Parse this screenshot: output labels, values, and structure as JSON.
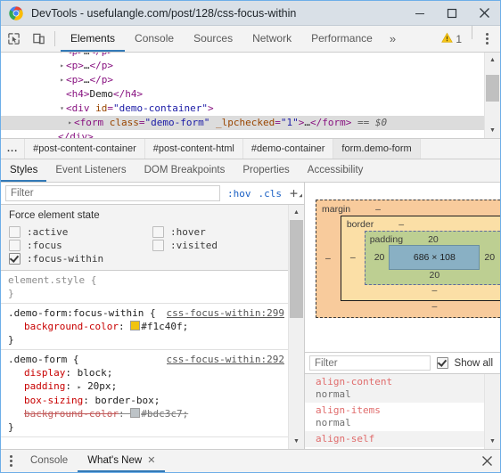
{
  "window": {
    "title": "DevTools - usefulangle.com/post/128/css-focus-within",
    "logo_icon": "chrome-logo-icon",
    "minimize_label": "—",
    "maximize_label": "□",
    "close_label": "✕"
  },
  "toolbar": {
    "inspect_icon": "inspect-element-icon",
    "device_icon": "device-toolbar-icon",
    "tabs": [
      {
        "label": "Elements",
        "active": true
      },
      {
        "label": "Console",
        "active": false
      },
      {
        "label": "Sources",
        "active": false
      },
      {
        "label": "Network",
        "active": false
      },
      {
        "label": "Performance",
        "active": false
      }
    ],
    "more_label": "»",
    "warning_icon": "warning-triangle-icon",
    "warning_count": "1",
    "menu_icon": "kebab-menu-icon"
  },
  "dom_tree": {
    "lines": [
      {
        "indent": 4,
        "tri": "▸",
        "html": "p-ellipsis",
        "selected": false,
        "clipped_top": true
      },
      {
        "indent": 4,
        "tri": "▸",
        "html": "p-ellipsis",
        "selected": false
      },
      {
        "indent": 4,
        "tri": "▸",
        "html": "p-ellipsis",
        "selected": false
      },
      {
        "indent": 5,
        "tri": "",
        "html": "h4-demo",
        "selected": false
      },
      {
        "indent": 4,
        "tri": "▾",
        "html": "div-demo-container",
        "selected": false
      },
      {
        "indent": 5,
        "tri": "▸",
        "html": "form-demo-form",
        "selected": true
      },
      {
        "indent": 4,
        "tri": "",
        "html": "div-close",
        "selected": false,
        "clipped_bottom": true
      }
    ],
    "text": {
      "p_open": "<p>",
      "p_ellipsis": "…",
      "p_close": "</p>",
      "h4_open": "<h4>",
      "h4_text": "Demo",
      "h4_close": "</h4>",
      "div_open": "<div",
      "div_attr_name": "id",
      "div_attr_value": "\"demo-container\"",
      "gt": ">",
      "form_open": "<form",
      "form_class_name": "class",
      "form_class_value": "\"demo-form\"",
      "form_lp_name": "_lpchecked",
      "form_lp_value": "\"1\"",
      "form_close": "</form>",
      "dollar_ref": "== $0",
      "div_close": "</div>"
    }
  },
  "breadcrumb": {
    "overflow": "...",
    "items": [
      "#post-content-container",
      "#post-content-html",
      "#demo-container",
      "form.demo-form"
    ]
  },
  "sidebar_tabs": [
    {
      "label": "Styles",
      "active": true
    },
    {
      "label": "Event Listeners",
      "active": false
    },
    {
      "label": "DOM Breakpoints",
      "active": false
    },
    {
      "label": "Properties",
      "active": false
    },
    {
      "label": "Accessibility",
      "active": false
    }
  ],
  "styles": {
    "filter_placeholder": "Filter",
    "filter_value": "",
    "hov_label": ":hov",
    "cls_label": ".cls",
    "new_rule_label": "+",
    "force_state": {
      "title": "Force element state",
      "items": [
        {
          "label": ":active",
          "checked": false
        },
        {
          "label": ":hover",
          "checked": false
        },
        {
          "label": ":focus",
          "checked": false
        },
        {
          "label": ":visited",
          "checked": false
        },
        {
          "label": ":focus-within",
          "checked": true
        }
      ]
    },
    "rules": [
      {
        "selector": "element.style {",
        "source": "",
        "declarations": [],
        "close": "}"
      },
      {
        "selector": ".demo-form:focus-within {",
        "source": "css-focus-within:299",
        "declarations": [
          {
            "prop": "background-color",
            "value": "#f1c40f",
            "swatch": "#f1c40f",
            "struck": false,
            "expandable": false
          }
        ],
        "close": "}"
      },
      {
        "selector": ".demo-form {",
        "source": "css-focus-within:292",
        "declarations": [
          {
            "prop": "display",
            "value": "block",
            "swatch": "",
            "struck": false,
            "expandable": false
          },
          {
            "prop": "padding",
            "value": "20px",
            "swatch": "",
            "struck": false,
            "expandable": true
          },
          {
            "prop": "box-sizing",
            "value": "border-box",
            "swatch": "",
            "struck": false,
            "expandable": false
          },
          {
            "prop": "background-color",
            "value": "#bdc3c7",
            "swatch": "#bdc3c7",
            "struck": true,
            "expandable": false
          }
        ],
        "close": "}"
      }
    ]
  },
  "box_model": {
    "margin_label": "margin",
    "margin_top": "–",
    "margin_right": "–",
    "margin_bottom": "–",
    "margin_left": "–",
    "border_label": "border",
    "border_top": "–",
    "border_right": "–",
    "border_bottom": "–",
    "border_left": "–",
    "padding_label": "padding",
    "padding_top": "20",
    "padding_right": "20",
    "padding_bottom": "20",
    "padding_left": "20",
    "content_size": "686 × 108",
    "colors": {
      "margin": "#f8cb9c",
      "border": "#fbdfa6",
      "padding": "#bdcf92",
      "content": "#89b0c4"
    }
  },
  "computed": {
    "filter_placeholder": "Filter",
    "filter_value": "",
    "show_all_label": "Show all",
    "show_all_checked": true,
    "properties": [
      {
        "name": "align-content",
        "value": "normal"
      },
      {
        "name": "align-items",
        "value": "normal"
      },
      {
        "name": "align-self",
        "value": ""
      }
    ]
  },
  "drawer": {
    "menu_icon": "kebab-menu-icon",
    "tabs": [
      {
        "label": "Console",
        "active": false,
        "closable": false
      },
      {
        "label": "What's New",
        "active": true,
        "closable": true
      }
    ],
    "close_label": "✕",
    "close_tab_label": "✕"
  }
}
